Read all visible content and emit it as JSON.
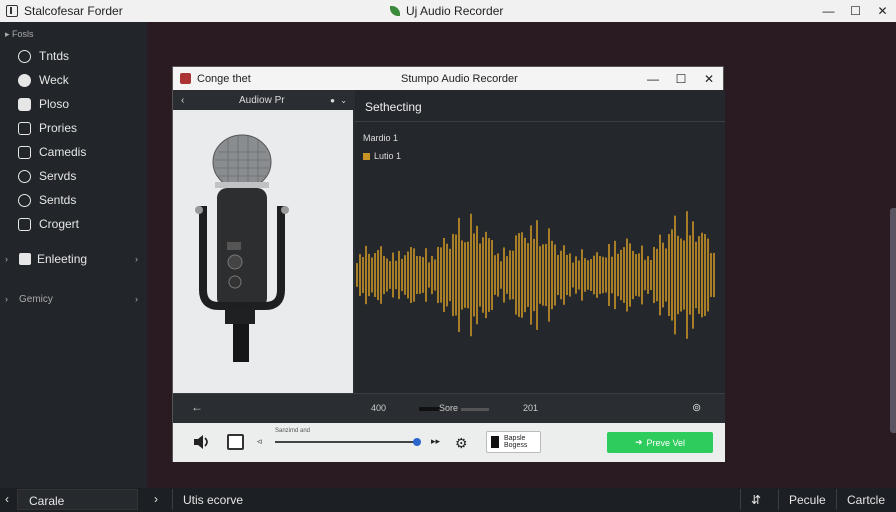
{
  "window": {
    "title": "Stalcofesar Forder",
    "center_title": "Uj Audio Recorder",
    "controls": [
      "—",
      "☐",
      "✕"
    ]
  },
  "sidebar": {
    "section_label": "Fosls",
    "items": [
      {
        "label": "Tntds",
        "icon": "tools-icon"
      },
      {
        "label": "Weck",
        "icon": "tag-icon"
      },
      {
        "label": "Ploso",
        "icon": "photo-icon"
      },
      {
        "label": "Prories",
        "icon": "folder-icon"
      },
      {
        "label": "Camedis",
        "icon": "camera-icon"
      },
      {
        "label": "Servds",
        "icon": "clock-icon"
      },
      {
        "label": "Sentds",
        "icon": "search-icon"
      },
      {
        "label": "Crogert",
        "icon": "settings-icon"
      }
    ],
    "groups": [
      {
        "label": "Enleeting"
      },
      {
        "label": "Gemicy"
      }
    ]
  },
  "dialog": {
    "app_name": "Conge thet",
    "title": "Stumpo Audio Recorder",
    "device_name": "Audiow Pr",
    "panel_header": "Sethecting",
    "tracks": [
      "Mardio 1",
      "Lutio 1"
    ],
    "transport": {
      "time_left": "400",
      "source_label": "Sore",
      "time_right": "201"
    },
    "toolbar": {
      "slider_label": "Sanzimd and",
      "file_button_line1": "Bapsle",
      "file_button_line2": "Bogess",
      "save_button": "Preve Vel",
      "accent_color": "#2ecc5c"
    },
    "wave_color": "#c99426"
  },
  "statusbar": {
    "left_button": "Carale",
    "mid_text": "Utis ecorve",
    "right_icon_label": "S",
    "btn_pecule": "Pecule",
    "btn_cartle": "Cartcle"
  }
}
